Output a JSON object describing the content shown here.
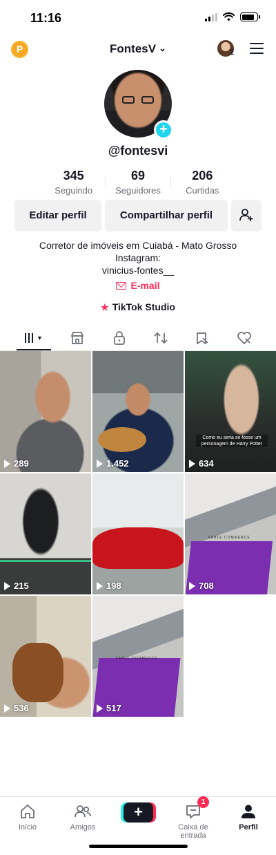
{
  "status_bar": {
    "time": "11:16",
    "battery_level": 0.85
  },
  "header": {
    "coin_label": "P",
    "username": "FontesV",
    "chevron": "⌄",
    "accounts_count": "2"
  },
  "profile": {
    "handle": "@fontesvi",
    "add_icon": "+",
    "stats": [
      {
        "value": "345",
        "label": "Seguindo"
      },
      {
        "value": "69",
        "label": "Seguidores"
      },
      {
        "value": "206",
        "label": "Curtidas"
      }
    ],
    "buttons": {
      "edit": "Editar perfil",
      "share": "Compartilhar perfil"
    },
    "bio_lines": [
      "Corretor de imóveis em Cuiabá - Mato Grosso",
      "Instagram:",
      "vinicius-fontes__"
    ],
    "email_label": "E-mail",
    "studio_label": "TikTok Studio",
    "studio_icon": "★"
  },
  "tabs": [
    {
      "icon": "grid-icon",
      "active": true
    },
    {
      "icon": "shop-icon",
      "glyph": "⌂"
    },
    {
      "icon": "lock-icon",
      "glyph": "🔒"
    },
    {
      "icon": "repost-icon",
      "glyph": "⇅"
    },
    {
      "icon": "bookmark-icon",
      "glyph": "⊘"
    },
    {
      "icon": "liked-icon",
      "glyph": "♡"
    }
  ],
  "videos": [
    {
      "views": "289"
    },
    {
      "views": "1.452"
    },
    {
      "views": "634",
      "caption": "Como eu seria se fosse um personagem de Harry Potter"
    },
    {
      "views": "215"
    },
    {
      "views": "198"
    },
    {
      "views": "708",
      "brand": "FABLE COMMERCE"
    },
    {
      "views": "536"
    },
    {
      "views": "517",
      "brand": "FABLE COMMERCE"
    }
  ],
  "bottom_nav": {
    "items": [
      {
        "label": "Início",
        "icon": "home-icon",
        "glyph": "⌂"
      },
      {
        "label": "Amigos",
        "icon": "friends-icon",
        "glyph": "⚇"
      },
      {
        "label": "Caixa de entrada",
        "icon": "inbox-icon",
        "glyph": "▭"
      },
      {
        "label": "Perfil",
        "icon": "profile-icon",
        "glyph": "●"
      }
    ],
    "create_label": "+",
    "inbox_badge": "1"
  },
  "colors": {
    "accent": "#fe2c55",
    "teal": "#20d5ec",
    "text": "#161823",
    "muted": "#6b6d75"
  }
}
